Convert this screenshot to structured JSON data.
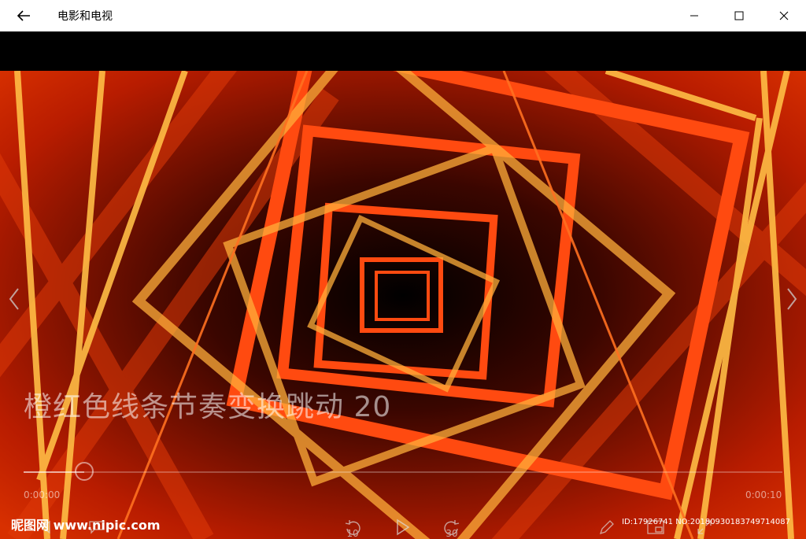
{
  "window": {
    "title": "电影和电视"
  },
  "video": {
    "title": "橙红色线条节奏变换跳动 20",
    "progress": 0.08,
    "time_elapsed": "0:00:00",
    "time_total": "0:00:10",
    "skip_back_label": "10",
    "skip_forward_label": "30"
  },
  "watermark": {
    "site": "昵图网 www.nipic.com",
    "id_text": "ID:17926741 NO:20180930183749714087"
  },
  "colors": {
    "accent_orange": "#ff5a14",
    "accent_yellow": "#ffb43c",
    "deep_red": "#c81e00"
  }
}
